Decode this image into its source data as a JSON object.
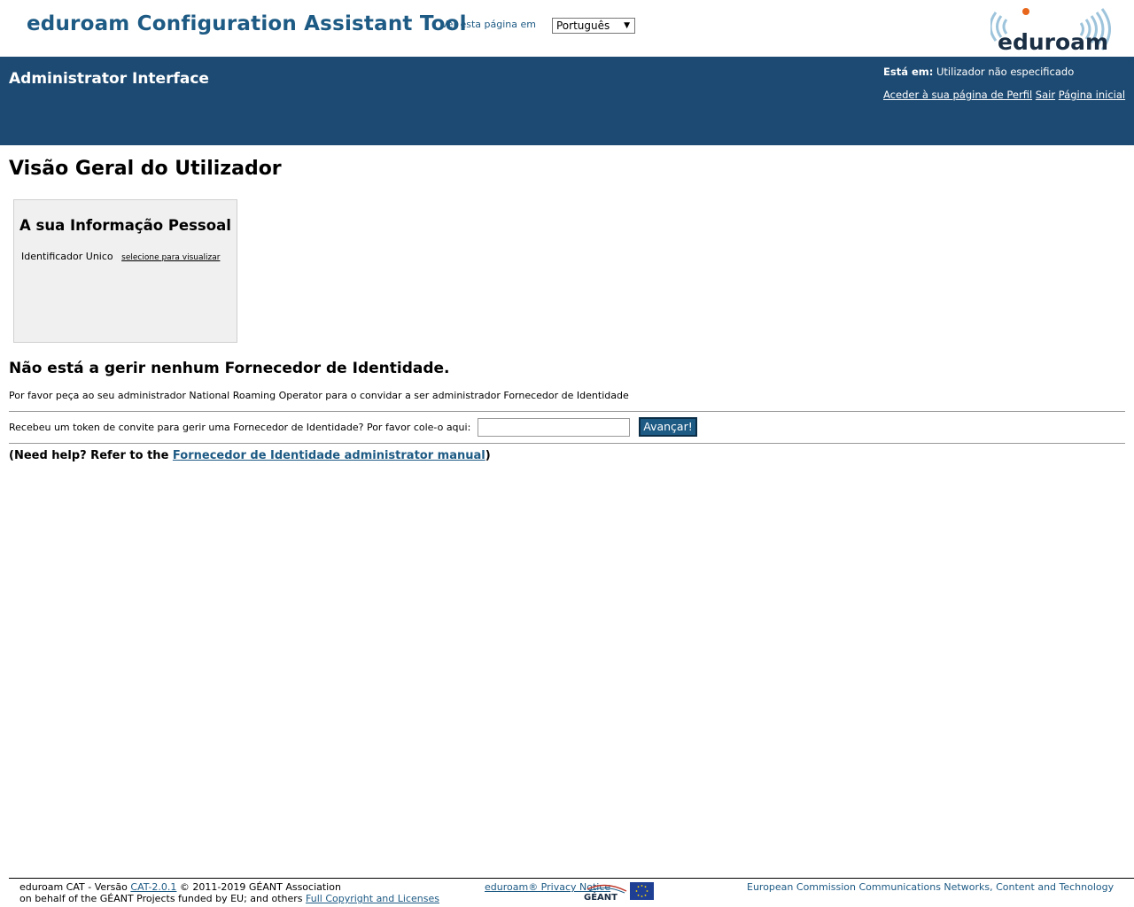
{
  "header": {
    "app_title": "eduroam Configuration Assistant Tool",
    "language_label": "Ver esta página em",
    "language_selected": "Português",
    "logo_text": "eduroam"
  },
  "band": {
    "title": "Administrator Interface",
    "status_label": "Está em:",
    "status_value": "Utilizador não especificado",
    "links": {
      "profile": "Aceder à sua página de Perfil",
      "logout": "Sair",
      "home": "Página inicial"
    }
  },
  "main": {
    "page_title": "Visão Geral do Utilizador",
    "personal_info": {
      "heading": "A sua Informação Pessoal",
      "id_label": "Identificador Unico",
      "id_link": "selecione para visualizar"
    },
    "no_idp_heading": "Não está a gerir nenhum Fornecedor de Identidade.",
    "invite_text": "Por favor peça ao seu administrador National Roaming Operator para o convidar a ser administrador Fornecedor de Identidade",
    "token_label": "Recebeu um token de convite para gerir uma Fornecedor de Identidade? Por favor cole-o aqui:",
    "token_value": "",
    "submit_label": "Avançar!",
    "help_prefix": "(Need help? Refer to the ",
    "help_link": "Fornecedor de Identidade administrator manual",
    "help_suffix": ")"
  },
  "footer": {
    "version_prefix": "eduroam CAT - Versão ",
    "version_link": "CAT-2.0.1",
    "copyright": " © 2011-2019 GÉANT Association",
    "funding_prefix": "on behalf of the GÉANT Projects funded by EU; and others ",
    "licenses_link": "Full Copyright and Licenses",
    "privacy_link": "eduroam® Privacy Notice",
    "geant_logo_text": "GÉANT",
    "ec_text": "European Commission Communications Networks, Content and Technology"
  },
  "colors": {
    "brand_blue": "#1d5a84",
    "band_blue": "#1d4a72",
    "box_gray": "#f0f0f0"
  }
}
